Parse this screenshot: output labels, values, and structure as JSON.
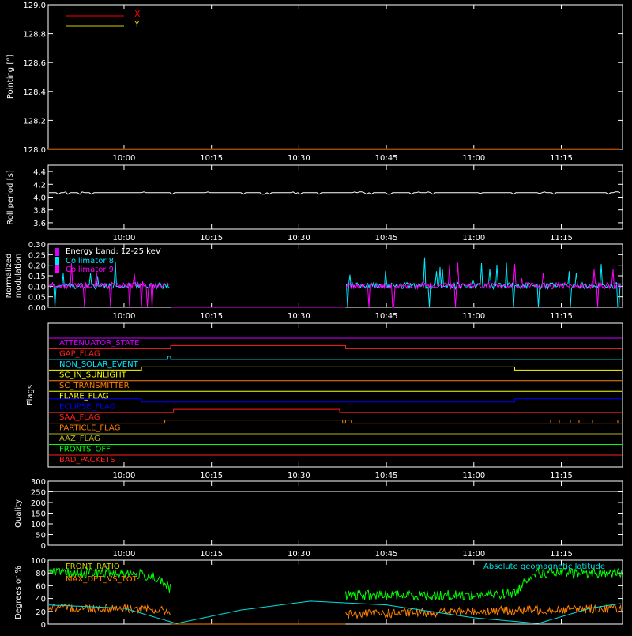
{
  "colors": {
    "background": "#000000",
    "axes": "#ffffff",
    "x_series": "#ff0000",
    "y_series": "#cfcf00",
    "roll": "#ffffff",
    "energy": "#d000ff",
    "coll8": "#00e8ff",
    "coll9": "#ff00ff",
    "quality": "#ffffff",
    "front_ratio": "#cfcf00",
    "front_series": "#00ff00",
    "max_series": "#ff8000",
    "geomag": "#00e0e0"
  },
  "time_ticks": [
    "10:00",
    "10:15",
    "10:30",
    "10:45",
    "11:00",
    "11:15"
  ],
  "time_range_minutes": [
    -13.0,
    85.5
  ],
  "chart_data": [
    {
      "type": "line",
      "ylabel": "Pointing [°]",
      "ylim": [
        128.0,
        129.0
      ],
      "yticks": [
        "128.0",
        "128.2",
        "128.4",
        "128.6",
        "128.8",
        "129.0"
      ],
      "legend": {
        "placement": "top-left",
        "entries": [
          "X",
          "Y"
        ]
      },
      "series": [
        {
          "name": "X",
          "x": [
            "09:47",
            "11:25"
          ],
          "values": [
            128.0,
            128.0
          ]
        },
        {
          "name": "Y",
          "x": [
            "09:47",
            "11:25"
          ],
          "values": [
            128.0,
            128.0
          ]
        }
      ]
    },
    {
      "type": "line",
      "ylabel": "Roll period [s]",
      "ylim": [
        3.5,
        4.5
      ],
      "yticks": [
        "3.6",
        "3.8",
        "4.0",
        "4.2",
        "4.4"
      ],
      "series": [
        {
          "x": [
            "09:47",
            "10:00",
            "10:15",
            "10:30",
            "10:45",
            "11:00",
            "11:15",
            "11:25"
          ],
          "values": [
            4.06,
            4.07,
            4.07,
            4.06,
            4.07,
            4.07,
            4.07,
            4.07
          ]
        }
      ]
    },
    {
      "type": "line",
      "ylabel": "Normalized modulation",
      "ylim": [
        0.0,
        0.3
      ],
      "yticks": [
        "0.00",
        "0.05",
        "0.10",
        "0.15",
        "0.20",
        "0.25",
        "0.30"
      ],
      "legend": {
        "placement": "top-left",
        "title": "Energy band: 12-25 keV",
        "entries": [
          "Collimator 8",
          "Collimator 9"
        ]
      },
      "series": [
        {
          "name": "Collimator 8",
          "x": [
            "09:47",
            "10:08",
            "10:08",
            "10:38",
            "10:38",
            "11:25"
          ],
          "values": [
            0.1,
            0.1,
            0.0,
            0.0,
            0.1,
            0.1
          ]
        },
        {
          "name": "Collimator 9",
          "x": [
            "09:47",
            "10:08",
            "10:08",
            "10:38",
            "10:38",
            "11:25"
          ],
          "values": [
            0.1,
            0.1,
            0.0,
            0.0,
            0.1,
            0.1
          ]
        }
      ]
    },
    {
      "type": "line",
      "ylabel": "Flags",
      "flags": [
        {
          "name": "ATTENUATOR_STATE",
          "color": "#d000ff",
          "segments": [
            [
              "09:47",
              0
            ],
            [
              "11:25",
              0
            ]
          ]
        },
        {
          "name": "GAP_FLAG",
          "color": "#ff2020",
          "segments": [
            [
              "09:47",
              0
            ],
            [
              "10:08",
              0
            ],
            [
              "10:08",
              1
            ],
            [
              "10:38",
              1
            ],
            [
              "10:38",
              0
            ],
            [
              "11:25",
              0
            ]
          ]
        },
        {
          "name": "NON_SOLAR_EVENT",
          "color": "#00e8ff",
          "segments": [
            [
              "09:47",
              0
            ],
            [
              "10:07.5",
              0
            ],
            [
              "10:07.5",
              1
            ],
            [
              "10:08",
              1
            ],
            [
              "10:08",
              0
            ],
            [
              "11:25",
              0
            ]
          ]
        },
        {
          "name": "SC_IN_SUNLIGHT",
          "color": "#ffff00",
          "segments": [
            [
              "09:47",
              0
            ],
            [
              "10:03",
              0
            ],
            [
              "10:03",
              1
            ],
            [
              "11:07",
              1
            ],
            [
              "11:07",
              0
            ],
            [
              "11:25",
              0
            ]
          ]
        },
        {
          "name": "SC_TRANSMITTER",
          "color": "#ff8000",
          "segments": [
            [
              "09:47",
              0
            ],
            [
              "11:25",
              0
            ]
          ]
        },
        {
          "name": "FLARE_FLAG",
          "color": "#ffff00",
          "segments": [
            [
              "09:47",
              0
            ],
            [
              "11:25",
              0
            ]
          ]
        },
        {
          "name": "ECLIPSE_FLAG",
          "color": "#0000ff",
          "segments": [
            [
              "09:47",
              1
            ],
            [
              "10:03",
              1
            ],
            [
              "10:03",
              0
            ],
            [
              "11:07",
              0
            ],
            [
              "11:07",
              1
            ],
            [
              "11:25",
              1
            ]
          ]
        },
        {
          "name": "SAA_FLAG",
          "color": "#ff2020",
          "segments": [
            [
              "09:47",
              0
            ],
            [
              "10:08.5",
              0
            ],
            [
              "10:08.5",
              1
            ],
            [
              "10:37",
              1
            ],
            [
              "10:37",
              0
            ],
            [
              "11:25",
              0
            ]
          ]
        },
        {
          "name": "PARTICLE_FLAG",
          "color": "#ff8000",
          "segments": [
            [
              "09:47",
              0
            ],
            [
              "10:07",
              0
            ],
            [
              "10:07",
              1
            ],
            [
              "10:37.5",
              1
            ],
            [
              "10:37.5",
              0
            ],
            [
              "10:38",
              0
            ],
            [
              "10:38",
              1
            ],
            [
              "10:39",
              1
            ],
            [
              "10:39",
              0
            ],
            [
              "11:25",
              0
            ]
          ]
        },
        {
          "name": "AAZ_FLAG",
          "color": "#b0b020",
          "segments": [
            [
              "09:47",
              0
            ],
            [
              "11:25",
              0
            ]
          ]
        },
        {
          "name": "FRONTS_OFF",
          "color": "#00ff00",
          "segments": [
            [
              "09:47",
              0
            ],
            [
              "11:25",
              0
            ]
          ]
        },
        {
          "name": "BAD_PACKETS",
          "color": "#ff2020",
          "segments": [
            [
              "09:47",
              0
            ],
            [
              "11:25",
              0
            ]
          ]
        }
      ]
    },
    {
      "type": "line",
      "ylabel": "Quality",
      "ylim": [
        0,
        300
      ],
      "yticks": [
        "0",
        "50",
        "100",
        "150",
        "200",
        "250",
        "300"
      ],
      "series": [
        {
          "x": [
            "09:47",
            "11:25"
          ],
          "values": [
            300,
            300
          ]
        }
      ]
    },
    {
      "type": "line",
      "ylabel": "Degrees or %",
      "ylim": [
        0,
        100
      ],
      "yticks": [
        "0",
        "20",
        "40",
        "60",
        "80",
        "100"
      ],
      "legend": {
        "placement": "top-left",
        "entries": [
          "FRONT_RATIO",
          "MAX_DET_VS_TOT"
        ],
        "right_entry": "Absolute geomagnetic latitude"
      },
      "series": [
        {
          "name": "FRONT_RATIO",
          "x": [
            "09:47",
            "10:00",
            "10:05",
            "10:08",
            "10:08",
            "10:38",
            "10:38",
            "11:00",
            "11:07",
            "11:10",
            "11:25"
          ],
          "values": [
            80,
            80,
            75,
            55,
            0,
            0,
            45,
            45,
            48,
            80,
            80
          ]
        },
        {
          "name": "MAX_DET_VS_TOT",
          "x": [
            "09:47",
            "10:00",
            "10:08",
            "10:08",
            "10:38",
            "10:38",
            "11:00",
            "11:25"
          ],
          "values": [
            25,
            25,
            20,
            0,
            0,
            15,
            20,
            25
          ]
        },
        {
          "name": "Absolute geomagnetic latitude",
          "x": [
            "09:47",
            "10:00",
            "10:09",
            "10:20",
            "10:32",
            "10:45",
            "11:00",
            "11:11",
            "11:20",
            "11:25"
          ],
          "values": [
            30,
            25,
            1,
            22,
            36,
            30,
            10,
            1,
            25,
            32
          ]
        }
      ]
    }
  ]
}
